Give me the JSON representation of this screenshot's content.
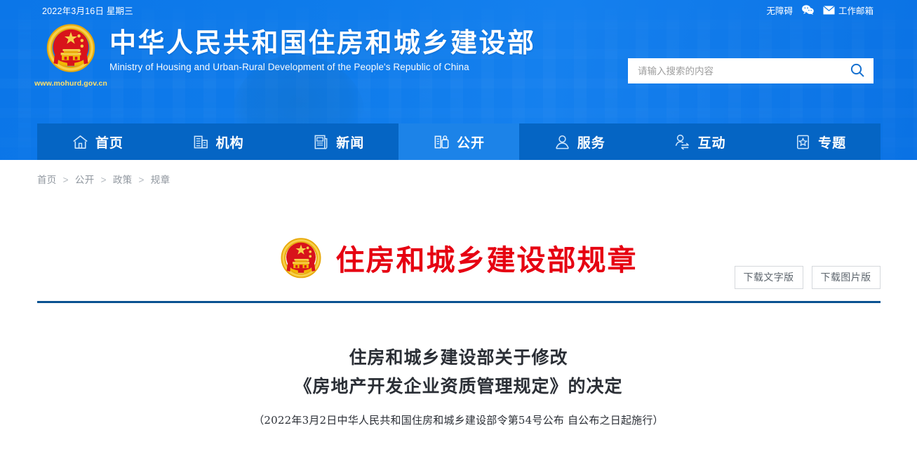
{
  "topbar": {
    "date": "2022年3月16日 星期三",
    "accessibility": "无障碍",
    "wechat_icon": "wechat-icon",
    "mail_icon": "mail-icon",
    "mail_label": "工作邮箱"
  },
  "brand": {
    "emblem_icon": "national-emblem-icon",
    "site_url": "www.mohurd.gov.cn",
    "name_cn": "中华人民共和国住房和城乡建设部",
    "name_en": "Ministry of Housing and Urban-Rural Development of the People's Republic of China"
  },
  "search": {
    "placeholder": "请输入搜索的内容",
    "value": "",
    "icon": "search-icon"
  },
  "nav": {
    "items": [
      {
        "label": "首页",
        "icon": "home-icon",
        "active": false
      },
      {
        "label": "机构",
        "icon": "building-icon",
        "active": false
      },
      {
        "label": "新闻",
        "icon": "newspaper-icon",
        "active": false
      },
      {
        "label": "公开",
        "icon": "documents-icon",
        "active": true
      },
      {
        "label": "服务",
        "icon": "user-service-icon",
        "active": false
      },
      {
        "label": "互动",
        "icon": "interaction-icon",
        "active": false
      },
      {
        "label": "专题",
        "icon": "star-card-icon",
        "active": false
      }
    ]
  },
  "breadcrumb": {
    "items": [
      "首页",
      "公开",
      "政策",
      "规章"
    ],
    "separator": ">"
  },
  "doc": {
    "banner_emblem_icon": "national-emblem-icon",
    "banner_title": "住房和城乡建设部规章",
    "download_text": "下载文字版",
    "download_image": "下载图片版",
    "title_line1": "住房和城乡建设部关于修改",
    "title_line2": "《房地产开发企业资质管理规定》的决定",
    "subtitle": "（2022年3月2日中华人民共和国住房和城乡建设部令第54号公布  自公布之日起施行）"
  },
  "colors": {
    "header_blue": "#0f7ceb",
    "nav_blue": "#0565c4",
    "nav_active_blue": "#1c83e8",
    "brand_red": "#e60012",
    "divider_blue": "#0a5291",
    "emblem_gold": "#f5c518",
    "url_gold": "#ffe06a"
  }
}
